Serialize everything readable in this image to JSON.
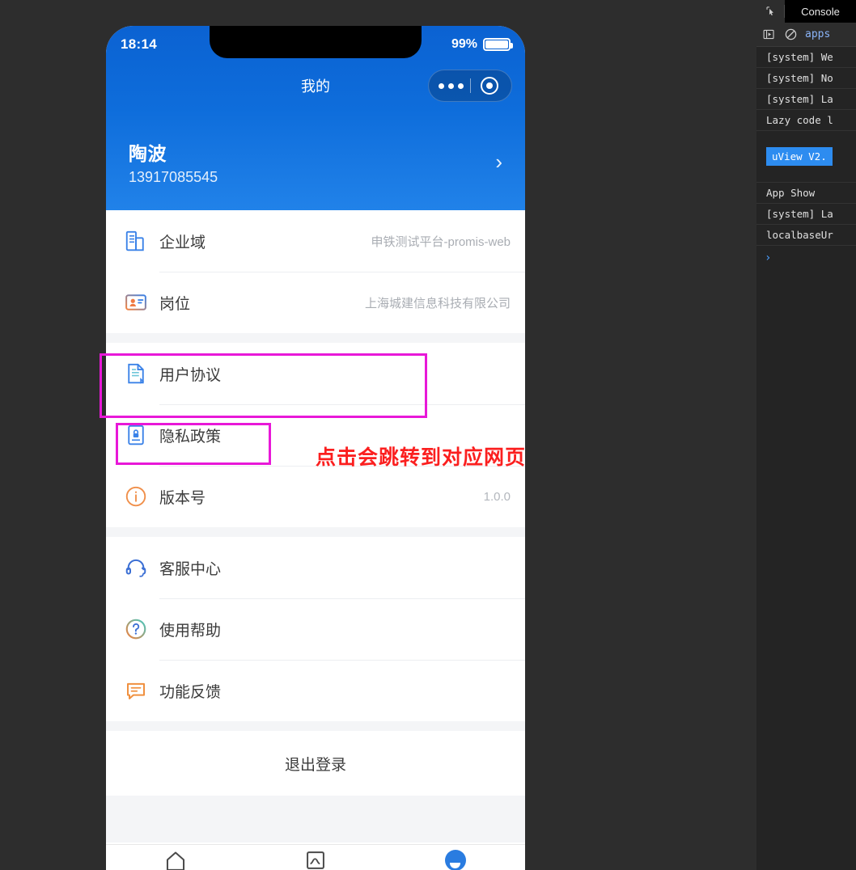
{
  "phone": {
    "status_bar": {
      "time": "18:14",
      "battery_percent": "99%",
      "battery_icon": "battery-icon"
    },
    "navbar": {
      "title": "我的",
      "capsule": {
        "more_icon": "more-dots-icon",
        "target_icon": "target-circle-icon"
      }
    },
    "profile": {
      "name": "陶波",
      "phone": "13917085545",
      "chevron": "›",
      "chevron_icon": "chevron-right-icon"
    },
    "groups": [
      {
        "rows": [
          {
            "icon": "building-icon",
            "label": "企业域",
            "value": "申铁测试平台-promis-web"
          },
          {
            "icon": "id-card-icon",
            "label": "岗位",
            "value": "上海城建信息科技有限公司"
          }
        ]
      },
      {
        "rows": [
          {
            "icon": "document-icon",
            "label": "用户协议",
            "value": ""
          },
          {
            "icon": "privacy-lock-icon",
            "label": "隐私政策",
            "value": ""
          },
          {
            "icon": "info-circle-icon",
            "label": "版本号",
            "value": "1.0.0"
          }
        ]
      },
      {
        "rows": [
          {
            "icon": "headset-icon",
            "label": "客服中心",
            "value": ""
          },
          {
            "icon": "question-circle-icon",
            "label": "使用帮助",
            "value": ""
          },
          {
            "icon": "feedback-chat-icon",
            "label": "功能反馈",
            "value": ""
          }
        ]
      }
    ],
    "logout_label": "退出登录",
    "tabbar": [
      {
        "icon": "home-icon",
        "active": false
      },
      {
        "icon": "chart-box-icon",
        "active": false
      },
      {
        "icon": "profile-avatar-icon",
        "active": true
      }
    ]
  },
  "annotations": {
    "color_box": "#e818d8",
    "color_text": "#fb1f1f",
    "note": "点击会跳转到对应网页"
  },
  "devtools": {
    "inspect_icon": "cursor-inspect-icon",
    "active_tab": "Console",
    "toolbar": {
      "step_icon": "step-into-icon",
      "clear_icon": "clear-console-icon",
      "filter_text": "apps"
    },
    "logs": [
      "[system] We",
      "[system] No",
      "[system] La",
      "Lazy code l"
    ],
    "badge": "uView V2.",
    "logs_after": [
      "App Show",
      "[system] La",
      "localbaseUr"
    ],
    "prompt": "›"
  }
}
